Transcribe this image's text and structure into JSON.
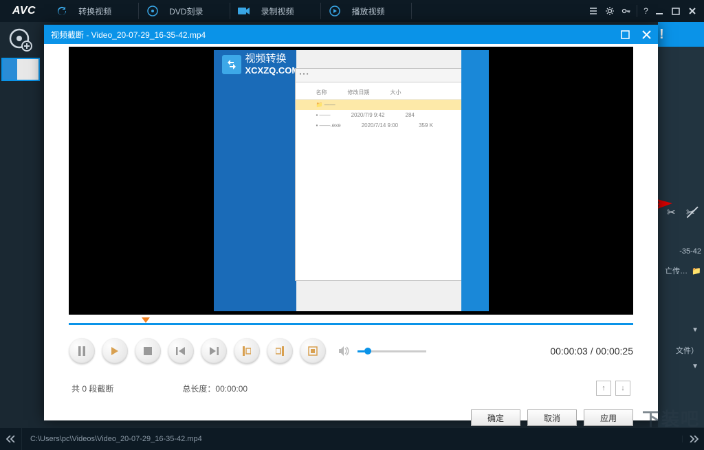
{
  "app": {
    "logo": "AVC"
  },
  "tabs": {
    "convert": "转换视频",
    "dvd": "DVD刻录",
    "record": "录制视频",
    "play": "播放视频"
  },
  "rightPanel": {
    "exclaim": "!",
    "fileFragment": "-35-42",
    "uploadFragment": "亡传…",
    "formatFragment": "文件）"
  },
  "modal": {
    "title": "视频截断 - Video_20-07-29_16-35-42.mp4",
    "watermark_label": "视频转换",
    "watermark_site": "XCXZQ.COM",
    "time_current": "00:00:03",
    "time_sep": " / ",
    "time_total": "00:00:25",
    "segments_prefix": "共 ",
    "segments_count": "0",
    "segments_suffix": " 段截断",
    "duration_label": "总长度：",
    "duration_value": "00:00:00",
    "ok": "确定",
    "cancel": "取消",
    "apply": "应用"
  },
  "statusbar": {
    "path": "C:\\Users\\pc\\Videos\\Video_20-07-29_16-35-42.mp4"
  },
  "corner_wm": "下装吧"
}
